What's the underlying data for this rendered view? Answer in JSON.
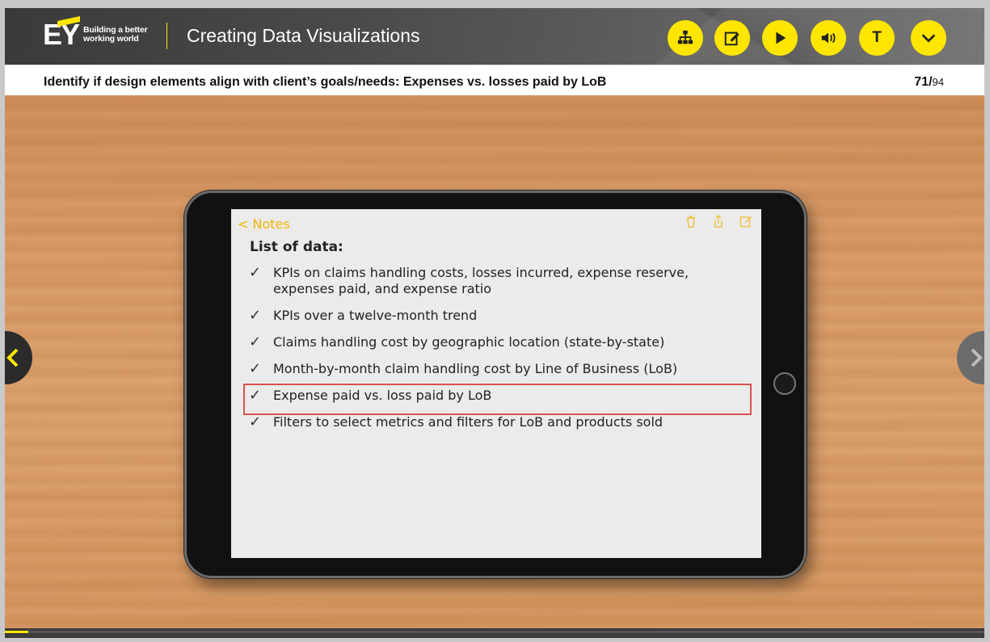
{
  "header": {
    "logo_mark": "EY",
    "logo_tagline_line1": "Building a better",
    "logo_tagline_line2": "working world",
    "title": "Creating Data Visualizations",
    "buttons": [
      {
        "name": "sitemap-button",
        "icon": "sitemap-icon"
      },
      {
        "name": "notes-button",
        "icon": "edit-icon"
      },
      {
        "name": "play-button",
        "icon": "play-icon"
      },
      {
        "name": "audio-button",
        "icon": "speaker-icon"
      },
      {
        "name": "transcript-button",
        "label": "T"
      },
      {
        "name": "menu-button",
        "icon": "chevron-down-icon"
      }
    ],
    "accent_color": "#ffe600"
  },
  "subheader": {
    "title": "Identify if design elements align with client’s goals/needs: Expenses vs. losses paid by LoB",
    "current_page": "71",
    "separator": "/",
    "total_pages": "94"
  },
  "tablet": {
    "back_label": "< Notes",
    "toolbar_icons": [
      "trash-icon",
      "share-icon",
      "compose-icon"
    ],
    "list_title": "List of data:",
    "items": [
      {
        "text": "KPIs on claims handling costs, losses incurred, expense reserve, expenses paid, and expense ratio",
        "highlighted": false
      },
      {
        "text": "KPIs over a twelve-month trend",
        "highlighted": false
      },
      {
        "text": "Claims handling cost by geographic location (state-by-state)",
        "highlighted": false
      },
      {
        "text": "Month-by-month claim handling cost by Line of Business (LoB)",
        "highlighted": false
      },
      {
        "text": "Expense paid vs. loss paid by LoB",
        "highlighted": true
      },
      {
        "text": "Filters to select metrics and filters for LoB and products sold",
        "highlighted": false
      }
    ],
    "highlight_color": "#d9534f"
  },
  "navigation": {
    "prev_icon": "chevron-left-icon",
    "next_icon": "chevron-right-icon"
  },
  "progress": {
    "fraction": 0.024
  }
}
